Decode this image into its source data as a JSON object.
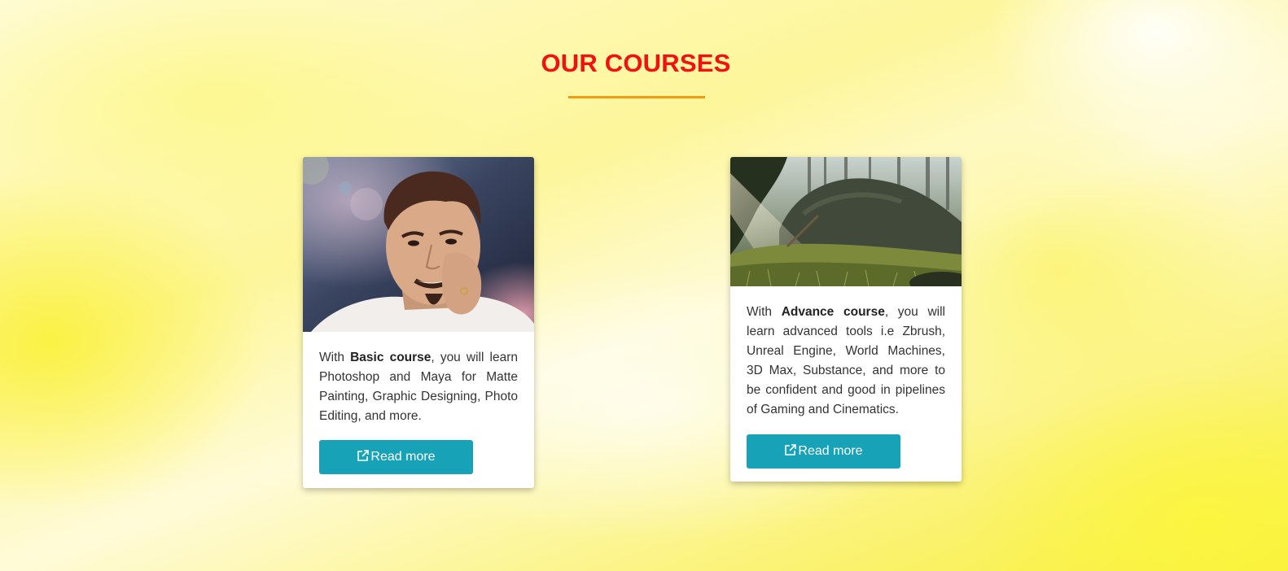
{
  "section": {
    "title": "OUR COURSES",
    "title_color": "#f50f0f",
    "underline_color": "#f39c12"
  },
  "courses": [
    {
      "image_icon": "portrait-image",
      "text_prefix": "With ",
      "course_name": "Basic course",
      "text_suffix": ", you will learn Photoshop and Maya for Matte Painting, Graphic Designing, Photo Editing, and more.",
      "button_label": "Read more",
      "button_icon": "external-link-icon"
    },
    {
      "image_icon": "forest-landscape-image",
      "text_prefix": "With ",
      "course_name": "Advance course",
      "text_suffix": ", you will learn advanced tools i.e Zbrush, Unreal Engine, World Machines, 3D Max, Substance, and more to be confident and good in pipelines of Gaming and Cinematics.",
      "button_label": "Read more",
      "button_icon": "external-link-icon"
    }
  ],
  "colors": {
    "button_bg": "#17a2b8",
    "button_text": "#ffffff"
  }
}
